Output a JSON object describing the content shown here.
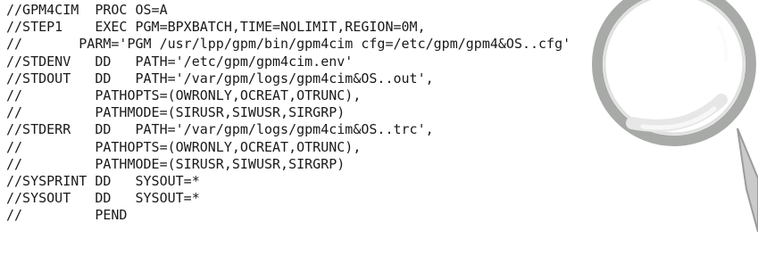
{
  "document": {
    "lines": [
      "//GPM4CIM  PROC OS=A",
      "//STEP1    EXEC PGM=BPXBATCH,TIME=NOLIMIT,REGION=0M,",
      "//       PARM='PGM /usr/lpp/gpm/bin/gpm4cim cfg=/etc/gpm/gpm4&OS..cfg'",
      "//STDENV   DD   PATH='/etc/gpm/gpm4cim.env'",
      "//STDOUT   DD   PATH='/var/gpm/logs/gpm4cim&OS..out',",
      "//         PATHOPTS=(OWRONLY,OCREAT,OTRUNC),",
      "//         PATHMODE=(SIRUSR,SIWUSR,SIRGRP)",
      "//STDERR   DD   PATH='/var/gpm/logs/gpm4cim&OS..trc',",
      "//         PATHOPTS=(OWRONLY,OCREAT,OTRUNC),",
      "//         PATHMODE=(SIRUSR,SIWUSR,SIRGRP)",
      "//SYSPRINT DD   SYSOUT=*",
      "//SYSOUT   DD   SYSOUT=*",
      "//         PEND"
    ]
  },
  "colors": {
    "text": "#1a1a1a",
    "background": "#ffffff",
    "magnifier_rim": "#a8aaa8",
    "magnifier_lens": "#f3f4f3"
  },
  "icons": {
    "magnifier": "magnifying-glass-icon"
  }
}
